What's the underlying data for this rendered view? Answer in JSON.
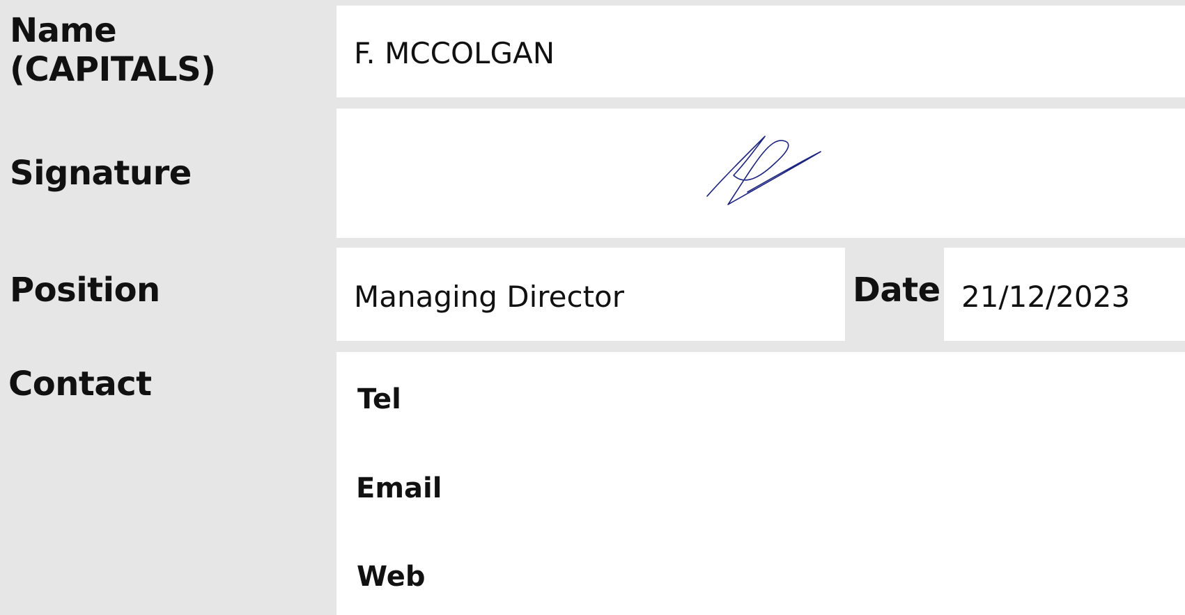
{
  "labels": {
    "name": "Name\n(CAPITALS)",
    "name_line1": "Name",
    "name_line2": "(CAPITALS)",
    "signature": "Signature",
    "position": "Position",
    "date": "Date",
    "contact": "Contact"
  },
  "values": {
    "name": "F. MCCOLGAN",
    "position": "Managing Director",
    "date": "21/12/2023"
  },
  "contact": {
    "tel_label": "Tel",
    "email_label": "Email",
    "web_label": "Web"
  },
  "colors": {
    "background": "#e6e6e6",
    "field": "#ffffff",
    "text": "#111111",
    "signature_ink": "#1a237e"
  }
}
